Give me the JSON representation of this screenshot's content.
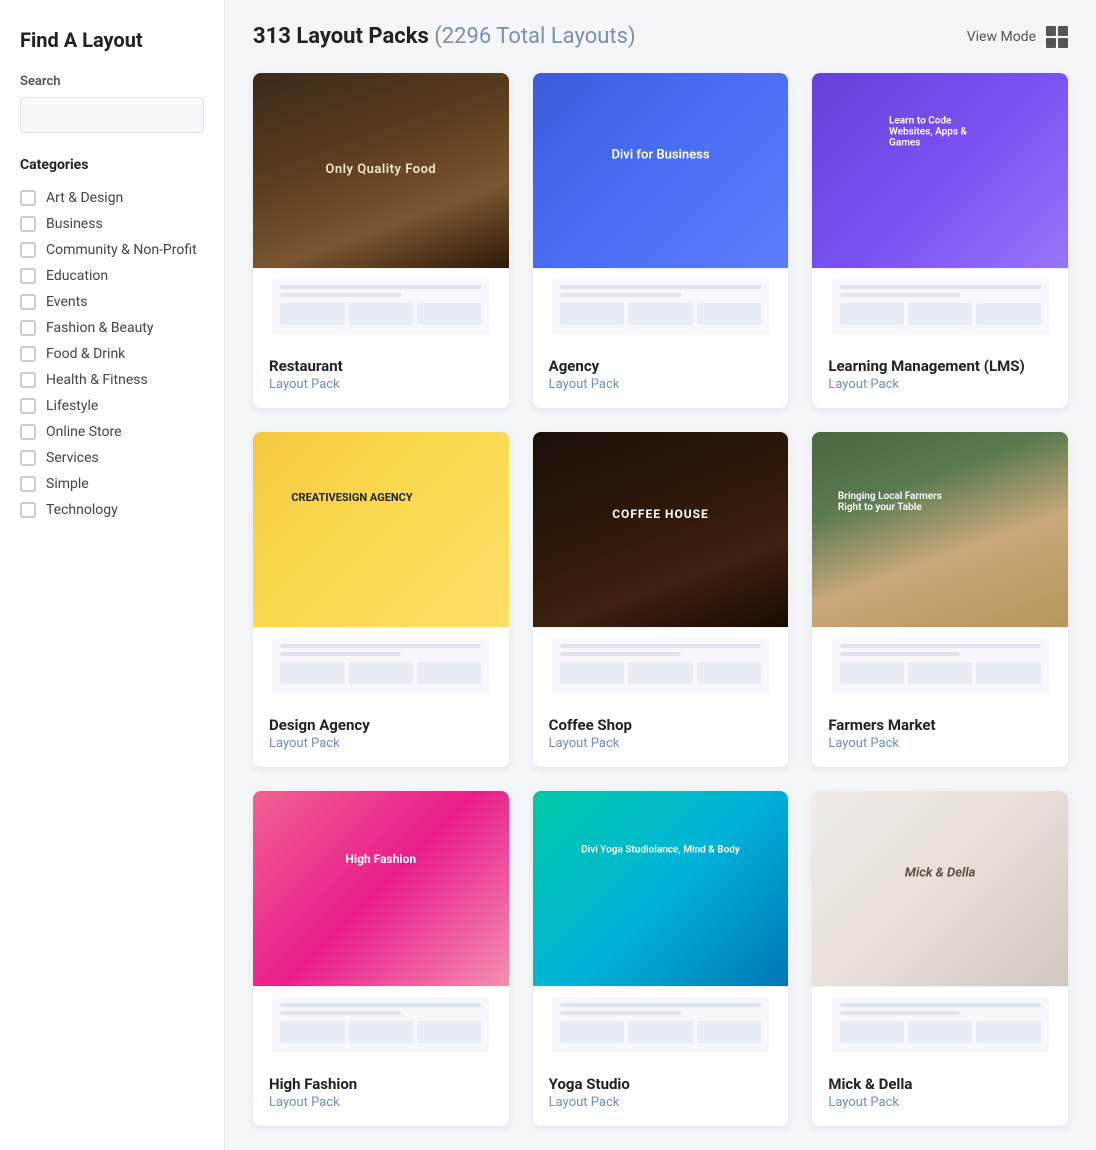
{
  "sidebar": {
    "title": "Find A Layout",
    "search": {
      "label": "Search",
      "placeholder": ""
    },
    "categories_label": "Categories",
    "categories": [
      {
        "id": "art-design",
        "name": "Art & Design",
        "checked": false
      },
      {
        "id": "business",
        "name": "Business",
        "checked": false
      },
      {
        "id": "community-nonprofit",
        "name": "Community & Non-Profit",
        "checked": false
      },
      {
        "id": "education",
        "name": "Education",
        "checked": false
      },
      {
        "id": "events",
        "name": "Events",
        "checked": false
      },
      {
        "id": "fashion-beauty",
        "name": "Fashion & Beauty",
        "checked": false
      },
      {
        "id": "food-drink",
        "name": "Food & Drink",
        "checked": false
      },
      {
        "id": "health-fitness",
        "name": "Health & Fitness",
        "checked": false
      },
      {
        "id": "lifestyle",
        "name": "Lifestyle",
        "checked": false
      },
      {
        "id": "online-store",
        "name": "Online Store",
        "checked": false
      },
      {
        "id": "services",
        "name": "Services",
        "checked": false
      },
      {
        "id": "simple",
        "name": "Simple",
        "checked": false
      },
      {
        "id": "technology",
        "name": "Technology",
        "checked": false
      }
    ]
  },
  "header": {
    "title": "313 Layout Packs",
    "subtitle": "(2296 Total Layouts)",
    "view_mode_label": "View Mode"
  },
  "cards": [
    {
      "id": "restaurant",
      "name": "Restaurant",
      "type": "Layout Pack",
      "image_class": "img-restaurant"
    },
    {
      "id": "agency",
      "name": "Agency",
      "type": "Layout Pack",
      "image_class": "img-agency"
    },
    {
      "id": "lms",
      "name": "Learning Management (LMS)",
      "type": "Layout Pack",
      "image_class": "img-lms"
    },
    {
      "id": "design-agency",
      "name": "Design Agency",
      "type": "Layout Pack",
      "image_class": "img-design-agency"
    },
    {
      "id": "coffee-shop",
      "name": "Coffee Shop",
      "type": "Layout Pack",
      "image_class": "img-coffee"
    },
    {
      "id": "farmers-market",
      "name": "Farmers Market",
      "type": "Layout Pack",
      "image_class": "img-farmers"
    },
    {
      "id": "fashion",
      "name": "High Fashion",
      "type": "Layout Pack",
      "image_class": "img-fashion"
    },
    {
      "id": "yoga",
      "name": "Yoga Studio",
      "type": "Layout Pack",
      "image_class": "img-yoga"
    },
    {
      "id": "wedding",
      "name": "Mick & Della",
      "type": "Layout Pack",
      "image_class": "img-wedding"
    }
  ]
}
